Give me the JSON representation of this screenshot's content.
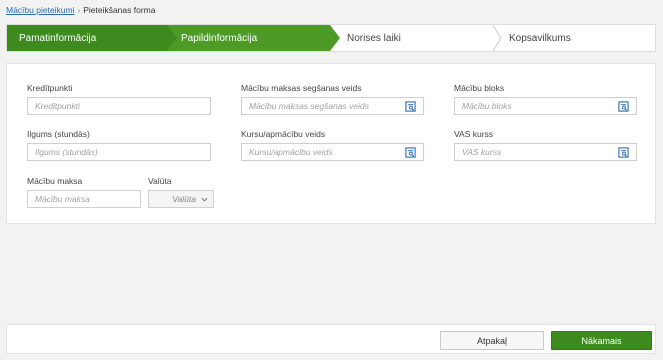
{
  "breadcrumb": {
    "link": "Mācību pieteikumi",
    "separator": "›",
    "current": "Pieteikšanas forma"
  },
  "wizard": {
    "steps": [
      {
        "label": "Pamatinformācija",
        "state": "done"
      },
      {
        "label": "Papildinformācija",
        "state": "active"
      },
      {
        "label": "Norises laiki",
        "state": "todo"
      },
      {
        "label": "Kopsavilkums",
        "state": "todo"
      }
    ]
  },
  "form": {
    "kreditpunkti": {
      "label": "Kredītpunkti",
      "placeholder": "Kredītpunkti"
    },
    "maksas_veids": {
      "label": "Mācību maksas segšanas veids",
      "placeholder": "Mācību maksas segšanas veids",
      "icon": "lookup-icon"
    },
    "macibu_bloks": {
      "label": "Mācību bloks",
      "placeholder": "Mācību bloks",
      "icon": "lookup-icon"
    },
    "ilgums": {
      "label": "Ilgums (stundās)",
      "placeholder": "Ilgums (stundās)"
    },
    "kursu_veids": {
      "label": "Kursu/apmācību veids",
      "placeholder": "Kursu/apmācību veids",
      "icon": "lookup-icon"
    },
    "vas_kurss": {
      "label": "VAS kurss",
      "placeholder": "VAS kurss",
      "icon": "lookup-icon"
    },
    "macibu_maksa": {
      "label": "Mācību maksa",
      "placeholder": "Mācību maksa"
    },
    "valuta": {
      "label": "Valūta",
      "selected": "Valūta"
    }
  },
  "footer": {
    "back_label": "Atpakaļ",
    "next_label": "Nākamais"
  },
  "colors": {
    "accent_green": "#3d8a1e",
    "link_blue": "#2b6cb0"
  }
}
